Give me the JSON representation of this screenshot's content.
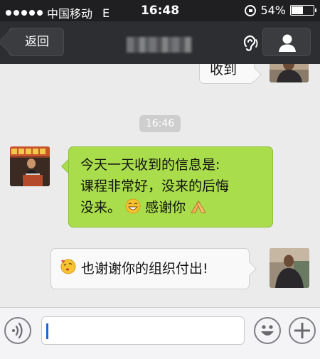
{
  "status_bar": {
    "carrier": "中国移动",
    "network": "E",
    "time": "16:48",
    "battery": "54%",
    "battery_level": 0.54
  },
  "nav": {
    "back_label": "返回",
    "icons": {
      "ear": "ear-speaker-icon",
      "profile": "person-icon"
    }
  },
  "messages": {
    "partial_top": "收到",
    "timestamp": "16:46",
    "received_line1": "今天一天收到的信息是:",
    "received_line2": "课程非常好，没来的后悔",
    "received_line3a": "没来。",
    "received_line3b": "感谢你",
    "sent": "也谢谢你的组织付出!"
  },
  "input": {
    "value": "",
    "placeholder": ""
  },
  "colors": {
    "nav_bg": "#2d2e31",
    "chat_bg": "#ebebeb",
    "green_bubble": "#a9dd4b",
    "white_bubble": "#f9f9f9",
    "timestamp_pill": "#cecece"
  }
}
